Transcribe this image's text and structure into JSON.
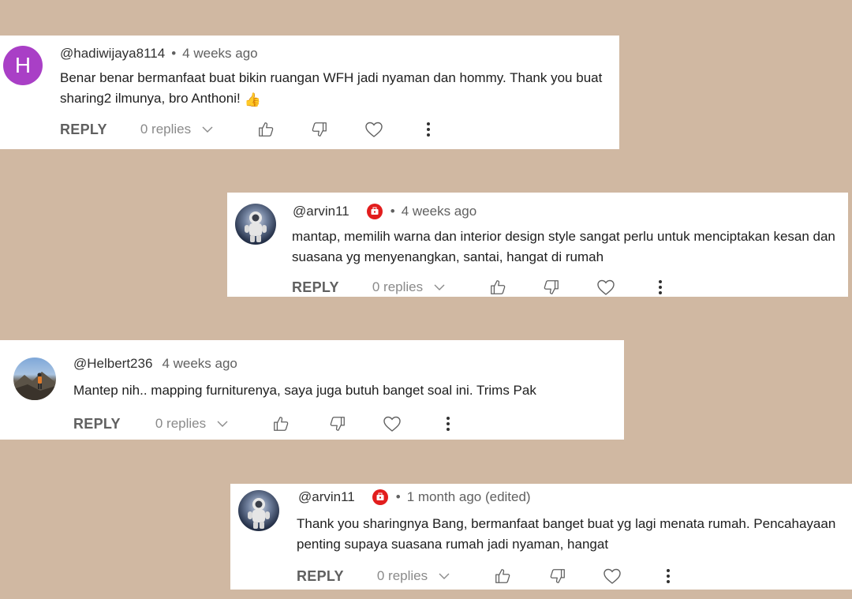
{
  "comments": [
    {
      "avatar_letter": "H",
      "handle": "@hadiwijaya8114",
      "separator": "•",
      "time": "4 weeks ago",
      "text": "Benar benar bermanfaat buat bikin ruangan WFH jadi nyaman dan hommy. Thank you buat sharing2 ilmunya, bro Anthoni!",
      "emoji": "👍",
      "reply_label": "REPLY",
      "replies_label": "0 replies"
    },
    {
      "handle": "@arvin11",
      "separator": "•",
      "time": "4 weeks ago",
      "text": "mantap, memilih warna dan interior design style sangat perlu untuk menciptakan kesan dan suasana yg menyenangkan, santai, hangat di rumah",
      "reply_label": "REPLY",
      "replies_label": "0 replies"
    },
    {
      "handle": "@Helbert236",
      "time": "4 weeks ago",
      "text": "Mantep nih.. mapping furniturenya, saya juga butuh banget soal ini. Trims Pak",
      "reply_label": "REPLY",
      "replies_label": "0 replies"
    },
    {
      "handle": "@arvin11",
      "separator": "•",
      "time": "1 month ago (edited)",
      "text": "Thank you sharingnya Bang, bermanfaat banget buat yg lagi menata rumah. Pencahayaan penting supaya suasana rumah jadi nyaman, hangat",
      "reply_label": "REPLY",
      "replies_label": "0 replies"
    }
  ],
  "colors": {
    "background": "#d0b8a2",
    "card": "#ffffff",
    "avatar_h": "#a93fc6",
    "badge": "#e21d1d",
    "icon": "#606060"
  },
  "icons": [
    "chevron-down-icon",
    "thumbs-up-icon",
    "thumbs-down-icon",
    "heart-icon",
    "more-vert-icon",
    "badge-icon"
  ]
}
